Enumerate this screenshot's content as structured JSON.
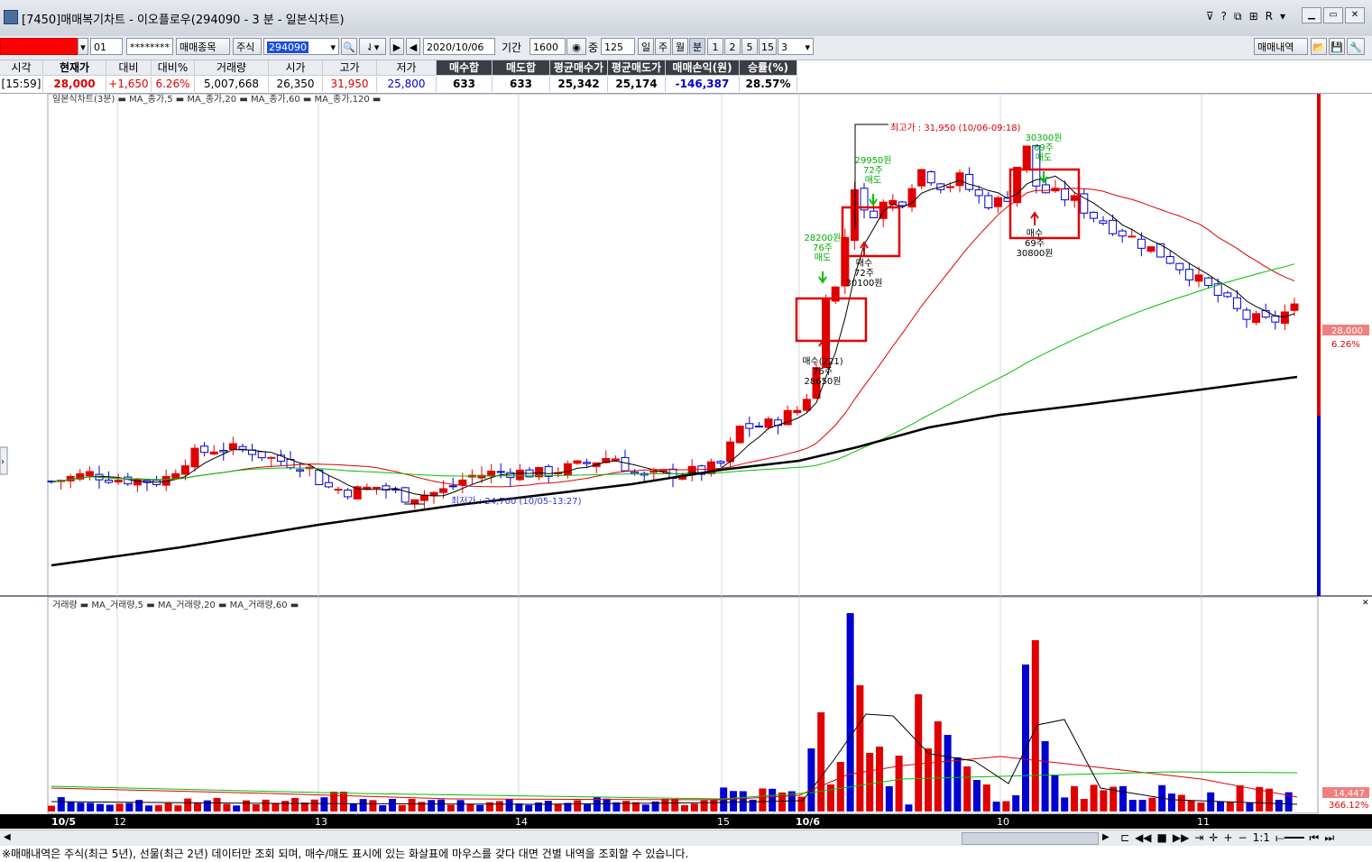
{
  "window": {
    "title": "[7450]매매복기차트 - 이오플로우(294090 - 3 분 - 일본식차트)"
  },
  "toolbar": {
    "account_no": "01",
    "password_mask": "********",
    "btn_stocks": "매매종목",
    "label_stock": "주식",
    "stock_code": "294090",
    "date": "2020/10/06",
    "label_period": "기간",
    "period": "1600",
    "label_mid": "중",
    "mid_value": "125",
    "p_day": "일",
    "p_week": "주",
    "p_month": "월",
    "p_minute": "분",
    "m1": "1",
    "m2": "2",
    "m5": "5",
    "m15": "15",
    "m3": "3",
    "btn_history": "매매내역"
  },
  "info": {
    "headers": [
      "시각",
      "현재가",
      "대비",
      "대비%",
      "거래량",
      "시가",
      "고가",
      "저가",
      "매수합",
      "매도합",
      "평균매수가",
      "평균매도가",
      "매매손익(원)",
      "승률(%)"
    ],
    "values": [
      "[15:59]",
      "28,000",
      "+1,650",
      "6.26%",
      "5,007,668",
      "26,350",
      "31,950",
      "25,800",
      "633",
      "633",
      "25,342",
      "25,174",
      "-146,387",
      "28.57%"
    ]
  },
  "price_panel": {
    "legend": "일본식차트(3분) ▬ MA_종가,5 ▬ MA_종가,20 ▬ MA_종가,60 ▬ MA_종가,120 ▬",
    "high_note": "최고가 : 31,950 (10/06-09:18)",
    "low_note": "최저가 : 24,700 (10/05-13:27)",
    "cur_price": "28,000",
    "cur_pct": "6.26%",
    "annotations": [
      {
        "lines": [
          "28200원",
          "76주",
          "매도"
        ],
        "color": "#00b000"
      },
      {
        "lines": [
          "29950원",
          "72주",
          "매도"
        ],
        "color": "#00b000"
      },
      {
        "lines": [
          "30300원",
          "69주",
          "매도"
        ],
        "color": "#00b000"
      },
      {
        "lines": [
          "매수(221)",
          "76주",
          "28650원"
        ],
        "color": "#000000"
      },
      {
        "lines": [
          "매수",
          "72주",
          "30100원"
        ],
        "color": "#000000"
      },
      {
        "lines": [
          "매수",
          "69주",
          "30800원"
        ],
        "color": "#000000"
      }
    ]
  },
  "volume_panel": {
    "legend": "거래량 ▬ MA_거래량,5 ▬ MA_거래량,20 ▬ MA_거래량,60 ▬",
    "cur_volume": "14,447",
    "cur_pct": "366.12%"
  },
  "x_axis": {
    "labels": [
      "10/5",
      "12",
      "13",
      "14",
      "15",
      "10/6",
      "10",
      "11"
    ]
  },
  "status_bar": {
    "text": "※매매내역은 주식(최근 5년), 선물(최근 2년) 데이터만 조회 되며, 매수/매도 표시에 있는 화살표에 마우스를 갖다 대면 건별 내역을 조회할 수 있습니다."
  },
  "colors": {
    "up": "#e00000",
    "down": "#0000d0",
    "ma5": "#000000",
    "ma20": "#e00000",
    "ma60": "#00c000",
    "ma120": "#000000"
  }
}
